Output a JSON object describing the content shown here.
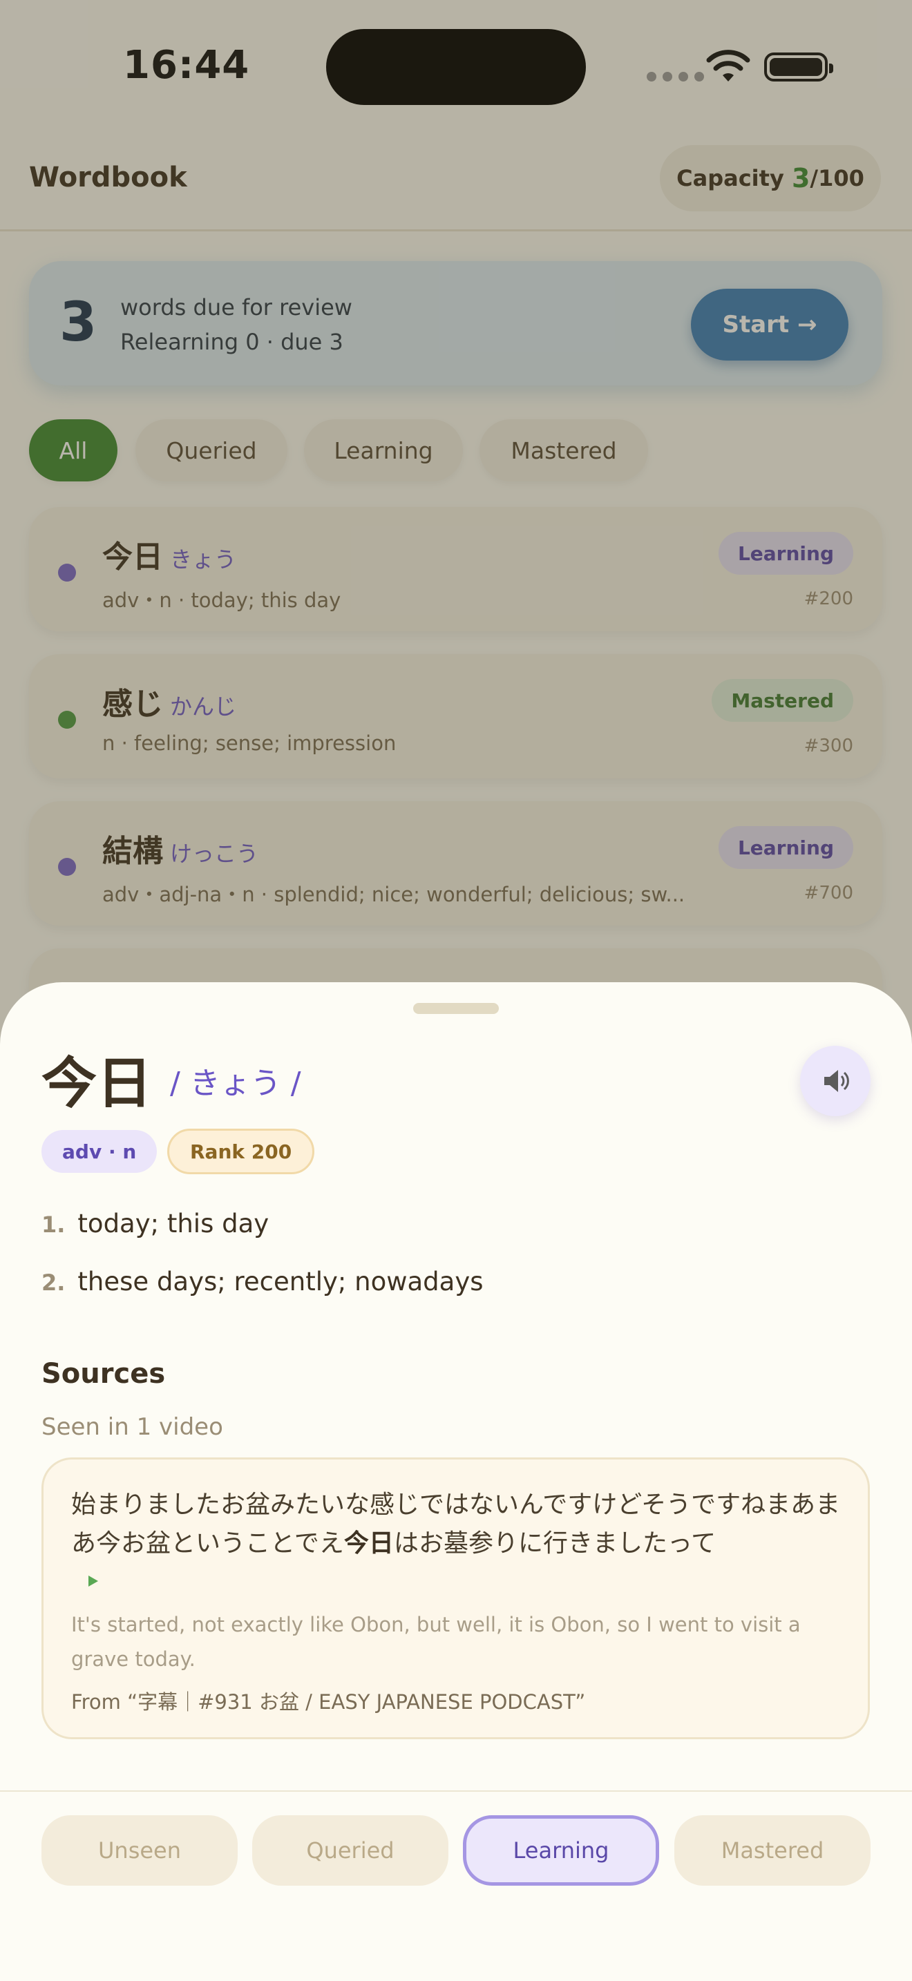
{
  "status_bar": {
    "time": "16:44"
  },
  "nav": {
    "title": "Wordbook",
    "capacity_label": "Capacity",
    "capacity_used": "3",
    "capacity_total": "/100"
  },
  "review": {
    "count": "3",
    "line1": "words due for review",
    "line2": "Relearning 0 · due 3",
    "start_label": "Start →"
  },
  "filters": [
    "All",
    "Queried",
    "Learning",
    "Mastered"
  ],
  "word_list": [
    {
      "word": "今日",
      "kana": "きょう",
      "def": "adv・n · today; this day",
      "status": "Learning",
      "rank": "#200",
      "dot_color": "#7a68c8"
    },
    {
      "word": "感じ",
      "kana": "かんじ",
      "def": "n · feeling; sense; impression",
      "status": "Mastered",
      "rank": "#300",
      "dot_color": "#4f9a45"
    },
    {
      "word": "結構",
      "kana": "けっこう",
      "def": "adv・adj-na・n · splendid; nice; wonderful; delicious; sw...",
      "status": "Learning",
      "rank": "#700",
      "dot_color": "#7a68c8"
    }
  ],
  "sheet": {
    "word": "今日",
    "reading": "/ きょう /",
    "pos_tag": "adv · n",
    "rank_tag": "Rank 200",
    "definitions": [
      {
        "num": "1.",
        "text": "today; this day"
      },
      {
        "num": "2.",
        "text": "these days; recently; nowadays"
      }
    ],
    "sources_title": "Sources",
    "seen_text": "Seen in 1 video",
    "source": {
      "jp_before": "始まりましたお盆みたいな感じではないんですけどそうですねまあまあ今お盆ということでえ",
      "jp_highlight": "今日",
      "jp_after": "はお墓参りに行きましたって",
      "en": "It's started, not exactly like Obon, but well, it is Obon, so I went to visit a grave today.",
      "from": "From “字幕｜#931 お盆 / EASY JAPANESE PODCAST”"
    },
    "status_buttons": [
      "Unseen",
      "Queried",
      "Learning",
      "Mastered"
    ],
    "active_status": "Learning"
  },
  "colors": {
    "accent_green": "#3f8a33",
    "accent_purple": "#6a55c6",
    "review_blue": "#3d7fb8"
  }
}
